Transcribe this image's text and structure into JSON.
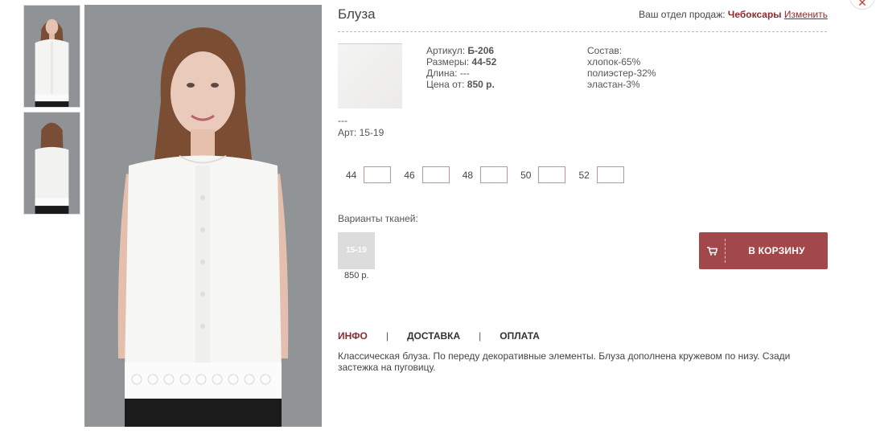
{
  "product": {
    "title": "Блуза",
    "specs": {
      "article_label": "Артикул:",
      "article_value": "Б-206",
      "sizes_label": "Размеры:",
      "sizes_value": "44-52",
      "length_label": "Длина:",
      "length_value": "---",
      "price_label": "Цена от:",
      "price_value": "850 р."
    },
    "composition": {
      "label": "Состав:",
      "items": [
        "хлопок-65%",
        "полиэстер-32%",
        "эластан-3%"
      ]
    },
    "note_line1": "---",
    "note_line2": "Арт: 15-19"
  },
  "sales_dept": {
    "label": "Ваш отдел продаж:",
    "city": "Чебоксары",
    "change_link": "Изменить"
  },
  "sizes": [
    {
      "label": "44",
      "value": ""
    },
    {
      "label": "46",
      "value": ""
    },
    {
      "label": "48",
      "value": ""
    },
    {
      "label": "50",
      "value": ""
    },
    {
      "label": "52",
      "value": ""
    }
  ],
  "variants": {
    "label": "Варианты тканей:",
    "items": [
      {
        "code": "15-19",
        "price": "850 р."
      }
    ]
  },
  "cart_button": {
    "label": "В КОРЗИНУ",
    "icon": "cart-icon"
  },
  "tabs": [
    {
      "label": "ИНФО",
      "active": true
    },
    {
      "label": "ДОСТАВКА",
      "active": false
    },
    {
      "label": "ОПЛАТА",
      "active": false
    }
  ],
  "description": "Классическая блуза. По переду декоративные элементы. Блуза дополнена кружевом по низу. Сзади застежка на пуговицу.",
  "close_icon": "close-icon",
  "colors": {
    "accent": "#a2484a",
    "link": "#8b2b2e"
  }
}
